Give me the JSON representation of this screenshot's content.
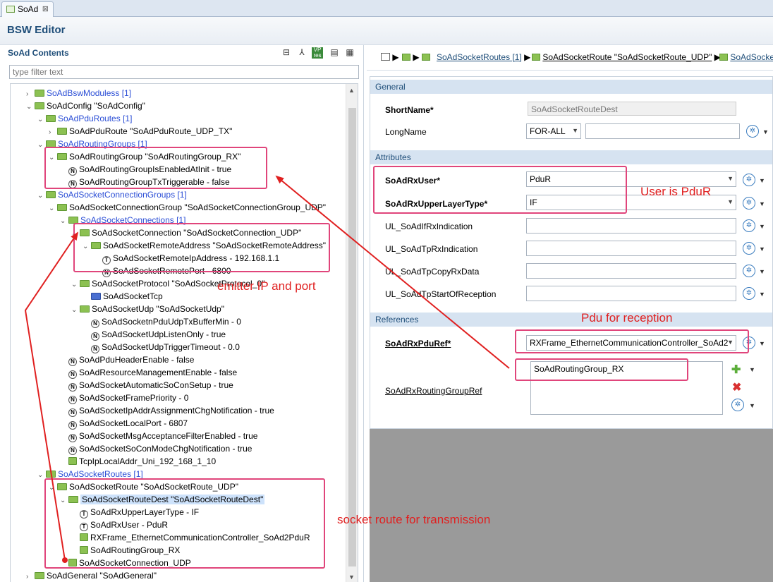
{
  "tab": {
    "label": "SoAd",
    "close": "⊠"
  },
  "editor": {
    "title": "BSW Editor"
  },
  "contents": {
    "title": "SoAd Contents",
    "filter_placeholder": "type filter text"
  },
  "tree": [
    {
      "text": "SoAdBswModuless [1]"
    },
    {
      "text": "SoAdConfig \"SoAdConfig\""
    },
    {
      "text": "SoAdPduRoutes [1]"
    },
    {
      "text": "SoAdPduRoute \"SoAdPduRoute_UDP_TX\""
    },
    {
      "text": "SoAdRoutingGroups [1]"
    },
    {
      "text": "SoAdRoutingGroup \"SoAdRoutingGroup_RX\""
    },
    {
      "text": "SoAdRoutingGroupIsEnabledAtInit - true"
    },
    {
      "text": "SoAdRoutingGroupTxTriggerable - false"
    },
    {
      "text": "SoAdSocketConnectionGroups [1]"
    },
    {
      "text": "SoAdSocketConnectionGroup \"SoAdSocketConnectionGroup_UDP\""
    },
    {
      "text": "SoAdSocketConnections [1]"
    },
    {
      "text": "SoAdSocketConnection \"SoAdSocketConnection_UDP\""
    },
    {
      "text": "SoAdSocketRemoteAddress \"SoAdSocketRemoteAddress\""
    },
    {
      "text": "SoAdSocketRemoteIpAddress - 192.168.1.1"
    },
    {
      "text": "SoAdSocketRemotePort - 6800"
    },
    {
      "text": "SoAdSocketProtocol \"SoAdSocketProtocol_0\""
    },
    {
      "text": "SoAdSocketTcp"
    },
    {
      "text": "SoAdSocketUdp \"SoAdSocketUdp\""
    },
    {
      "text": "SoAdSocketnPduUdpTxBufferMin - 0"
    },
    {
      "text": "SoAdSocketUdpListenOnly - true"
    },
    {
      "text": "SoAdSocketUdpTriggerTimeout - 0.0"
    },
    {
      "text": "SoAdPduHeaderEnable - false"
    },
    {
      "text": "SoAdResourceManagementEnable - false"
    },
    {
      "text": "SoAdSocketAutomaticSoConSetup - true"
    },
    {
      "text": "SoAdSocketFramePriority - 0"
    },
    {
      "text": "SoAdSocketIpAddrAssignmentChgNotification - true"
    },
    {
      "text": "SoAdSocketLocalPort - 6807"
    },
    {
      "text": "SoAdSocketMsgAcceptanceFilterEnabled - true"
    },
    {
      "text": "SoAdSocketSoConModeChgNotification - true"
    },
    {
      "text": "TcpIpLocalAddr_Uni_192_168_1_10"
    },
    {
      "text": "SoAdSocketRoutes [1]"
    },
    {
      "text": "SoAdSocketRoute \"SoAdSocketRoute_UDP\""
    },
    {
      "text": "SoAdSocketRouteDest \"SoAdSocketRouteDest\""
    },
    {
      "text": "SoAdRxUpperLayerType - IF"
    },
    {
      "text": "SoAdRxUser - PduR"
    },
    {
      "text": "RXFrame_EthernetCommunicationController_SoAd2PduR"
    },
    {
      "text": "SoAdRoutingGroup_RX"
    },
    {
      "text": "SoAdSocketConnection_UDP"
    },
    {
      "text": "SoAdGeneral \"SoAdGeneral\""
    }
  ],
  "breadcrumb": {
    "item1": "SoAdSocketRoutes [1]",
    "item2": "SoAdSocketRoute \"SoAdSocketRoute_UDP\"",
    "item3": "SoAdSocke"
  },
  "form": {
    "general_title": "General",
    "shortname_label": "ShortName*",
    "shortname_value": "SoAdSocketRouteDest",
    "longname_label": "LongName",
    "longname_lang": "FOR-ALL",
    "longname_value": "",
    "attributes_title": "Attributes",
    "rxuser_label": "SoAdRxUser*",
    "rxuser_value": "PduR",
    "rxupper_label": "SoAdRxUpperLayerType*",
    "rxupper_value": "IF",
    "ul1_label": "UL_SoAdIfRxIndication",
    "ul2_label": "UL_SoAdTpRxIndication",
    "ul3_label": "UL_SoAdTpCopyRxData",
    "ul4_label": "UL_SoAdTpStartOfReception",
    "references_title": "References",
    "pduref_label": "SoAdRxPduRef*",
    "pduref_value": "RXFrame_EthernetCommunicationController_SoAd2",
    "rgref_label": "SoAdRxRoutingGroupRef",
    "rgref_value": "SoAdRoutingGroup_RX"
  },
  "annotations": {
    "user": "User is PduR",
    "emitter": "emitter IP and port",
    "pdu": "Pdu for reception",
    "route": "socket route for transmission"
  },
  "colors": {
    "annotation_box": "#e0457b",
    "annotation_text": "#e02020",
    "arrow": "#e02020"
  }
}
